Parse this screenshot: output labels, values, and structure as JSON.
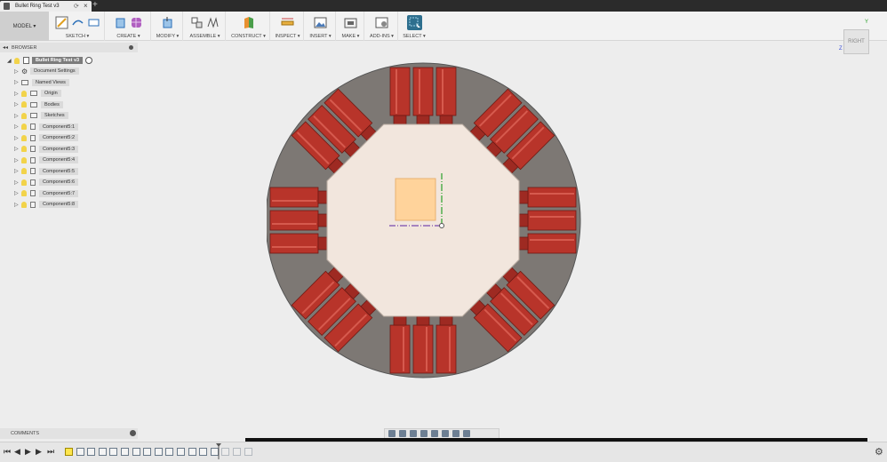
{
  "tab": {
    "title": "Bullet Ring Test v3",
    "sync_icon": "refresh-icon",
    "close": "×",
    "new_tab": "+"
  },
  "toolbar": {
    "model": "MODEL ▾",
    "groups": [
      {
        "label": "SKETCH ▾"
      },
      {
        "label": "CREATE ▾"
      },
      {
        "label": "MODIFY ▾"
      },
      {
        "label": "ASSEMBLE ▾"
      },
      {
        "label": "CONSTRUCT ▾"
      },
      {
        "label": "INSPECT ▾"
      },
      {
        "label": "INSERT ▾"
      },
      {
        "label": "MAKE ▾"
      },
      {
        "label": "ADD-INS ▾"
      },
      {
        "label": "SELECT ▾"
      }
    ]
  },
  "viewcube": {
    "face": "RIGHT",
    "y": "Y",
    "z": "Z"
  },
  "browser": {
    "header": "BROWSER",
    "root": "Bullet Ring Test v3",
    "items": [
      {
        "name": "Document Settings",
        "icon": "gear"
      },
      {
        "name": "Named Views",
        "icon": "folder"
      },
      {
        "name": "Origin",
        "icon": "folder"
      },
      {
        "name": "Bodies",
        "icon": "folder"
      },
      {
        "name": "Sketches",
        "icon": "folder"
      },
      {
        "name": "Component5:1",
        "icon": "component"
      },
      {
        "name": "Component5:2",
        "icon": "component"
      },
      {
        "name": "Component5:3",
        "icon": "component"
      },
      {
        "name": "Component5:4",
        "icon": "component"
      },
      {
        "name": "Component5:5",
        "icon": "component"
      },
      {
        "name": "Component5:6",
        "icon": "component"
      },
      {
        "name": "Component5:7",
        "icon": "component"
      },
      {
        "name": "Component5:8",
        "icon": "component"
      }
    ]
  },
  "comments": {
    "label": "COMMENTS"
  },
  "colors": {
    "ring": "#7d7874",
    "inner": "#f2e6dd",
    "bullet": "#b8342a",
    "sketch": "#ffd39b",
    "accent": "#2e6f8e"
  }
}
